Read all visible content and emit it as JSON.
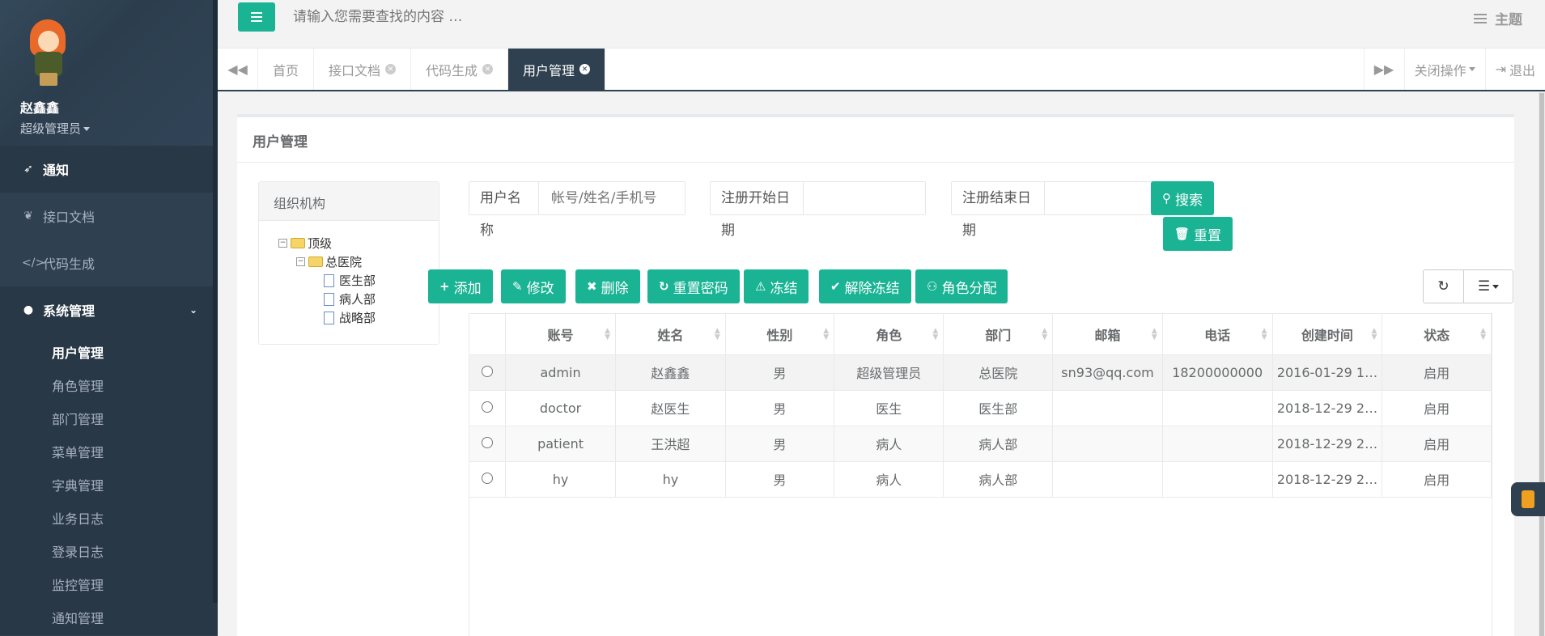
{
  "user": {
    "name": "赵鑫鑫",
    "role": "超级管理员"
  },
  "nav": {
    "items": [
      {
        "label": "通知",
        "icon": "rocket-icon"
      },
      {
        "label": "接口文档",
        "icon": "leaf-icon"
      },
      {
        "label": "代码生成",
        "icon": "code-icon"
      },
      {
        "label": "系统管理",
        "icon": "user-icon"
      }
    ],
    "sub_items": [
      "用户管理",
      "角色管理",
      "部门管理",
      "菜单管理",
      "字典管理",
      "业务日志",
      "登录日志",
      "监控管理",
      "通知管理"
    ]
  },
  "topbar": {
    "search_placeholder": "请输入您需要查找的内容 …",
    "theme_label": "主题"
  },
  "tabs": {
    "items": [
      "首页",
      "接口文档",
      "代码生成",
      "用户管理"
    ],
    "close_ops": "关闭操作",
    "logout": "退出"
  },
  "panel": {
    "title": "用户管理"
  },
  "org": {
    "title": "组织机构",
    "root": "顶级",
    "child": "总医院",
    "leaves": [
      "医生部",
      "病人部",
      "战略部"
    ]
  },
  "filters": {
    "username_label": "用户名称",
    "username_placeholder": "帐号/姓名/手机号",
    "start_label": "注册开始日期",
    "end_label": "注册结束日期"
  },
  "buttons": {
    "search": "搜索",
    "reset": "重置",
    "add": "添加",
    "edit": "修改",
    "delete": "删除",
    "reset_password": "重置密码",
    "freeze": "冻结",
    "unfreeze": "解除冻结",
    "role_assign": "角色分配"
  },
  "table": {
    "columns": [
      "账号",
      "姓名",
      "性别",
      "角色",
      "部门",
      "邮箱",
      "电话",
      "创建时间",
      "状态"
    ],
    "rows": [
      [
        "admin",
        "赵鑫鑫",
        "男",
        "超级管理员",
        "总医院",
        "sn93@qq.com",
        "18200000000",
        "2016-01-29 1…",
        "启用"
      ],
      [
        "doctor",
        "赵医生",
        "男",
        "医生",
        "医生部",
        "",
        "",
        "2018-12-29 2…",
        "启用"
      ],
      [
        "patient",
        "王洪超",
        "男",
        "病人",
        "病人部",
        "",
        "",
        "2018-12-29 2…",
        "启用"
      ],
      [
        "hy",
        "hy",
        "男",
        "病人",
        "病人部",
        "",
        "",
        "2018-12-29 2…",
        "启用"
      ]
    ]
  },
  "colors": {
    "accent": "#1ab394",
    "sidebar": "#2f4050"
  }
}
